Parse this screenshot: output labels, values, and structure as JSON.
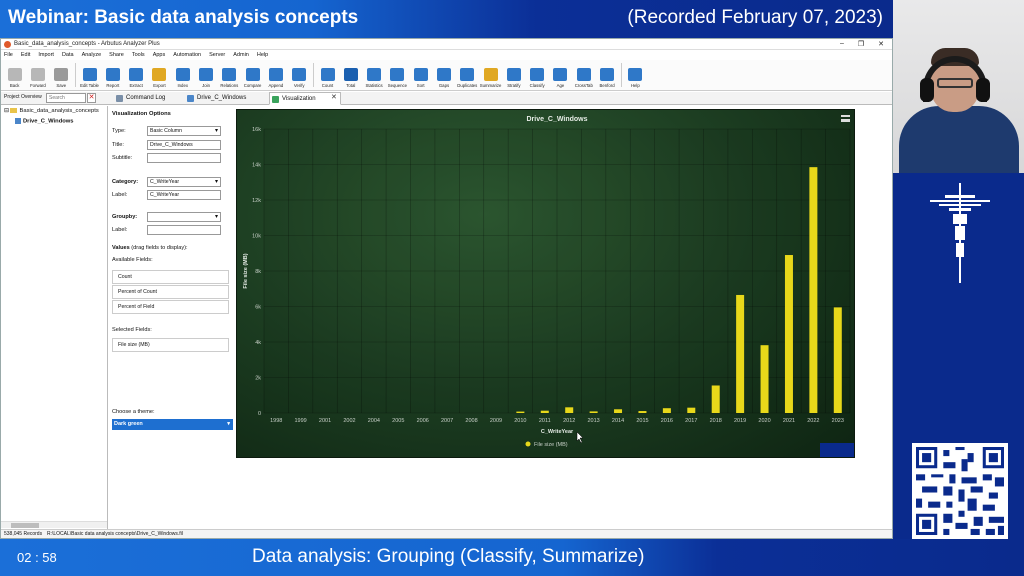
{
  "banner": {
    "title": "Webinar: Basic data analysis concepts",
    "date": "(Recorded February 07, 2023)"
  },
  "window": {
    "title": "Basic_data_analysis_concepts - Arbutus Analyzer Plus",
    "controls": [
      "–",
      "❐",
      "✕"
    ]
  },
  "menu": [
    "File",
    "Edit",
    "Import",
    "Data",
    "Analyze",
    "Share",
    "Tools",
    "Apps",
    "Automation",
    "Server",
    "Admin",
    "Help"
  ],
  "toolbar": [
    {
      "label": "Back",
      "color": "#b7b7b7"
    },
    {
      "label": "Forward",
      "color": "#b7b7b7"
    },
    {
      "label": "Save",
      "color": "#9a9a9a"
    },
    {
      "label": "Edit Table",
      "color": "#2f78c8"
    },
    {
      "label": "Report",
      "color": "#2f78c8"
    },
    {
      "label": "Extract",
      "color": "#2f78c8"
    },
    {
      "label": "Export",
      "color": "#e0a823"
    },
    {
      "label": "Index",
      "color": "#2f78c8"
    },
    {
      "label": "Join",
      "color": "#2f78c8"
    },
    {
      "label": "Relations",
      "color": "#2f78c8"
    },
    {
      "label": "Compare",
      "color": "#2f78c8"
    },
    {
      "label": "Append",
      "color": "#2f78c8"
    },
    {
      "label": "Verify",
      "color": "#2f78c8"
    },
    {
      "label": "Count",
      "color": "#2f78c8"
    },
    {
      "label": "Total",
      "color": "#1a5fb0"
    },
    {
      "label": "Statistics",
      "color": "#2f78c8"
    },
    {
      "label": "Sequence",
      "color": "#2f78c8"
    },
    {
      "label": "Sort",
      "color": "#2f78c8"
    },
    {
      "label": "Gaps",
      "color": "#2f78c8"
    },
    {
      "label": "Duplicates",
      "color": "#2f78c8"
    },
    {
      "label": "Summarize",
      "color": "#e0a823"
    },
    {
      "label": "Stratify",
      "color": "#2f78c8"
    },
    {
      "label": "Classify",
      "color": "#2f78c8"
    },
    {
      "label": "Age",
      "color": "#2f78c8"
    },
    {
      "label": "CrossTab",
      "color": "#2f78c8"
    },
    {
      "label": "Benford",
      "color": "#2f78c8"
    },
    {
      "label": "Help",
      "color": "#2f78c8"
    }
  ],
  "project": {
    "label": "Project Overview",
    "search_placeholder": "Search",
    "root": "Basic_data_analysis_concepts",
    "child": "Drive_C_Windows"
  },
  "tabs": [
    {
      "label": "Command Log",
      "active": false
    },
    {
      "label": "Drive_C_Windows",
      "active": false
    },
    {
      "label": "Visualization",
      "active": true
    }
  ],
  "options": {
    "heading": "Visualization Options",
    "type_label": "Type:",
    "type_value": "Basic Column",
    "title_label": "Title:",
    "title_value": "Drive_C_Windows",
    "subtitle_label": "Subtitle:",
    "subtitle_value": "",
    "category_label": "Category:",
    "category_value": "C_WriteYear",
    "cat_label_label": "Label:",
    "cat_label_value": "C_WriteYear",
    "groupby_label": "Groupby:",
    "groupby_value": "",
    "group_label_label": "Label:",
    "group_label_value": "",
    "values_heading": "Values",
    "values_hint": "(drag fields to display):",
    "available_label": "Available Fields:",
    "available_fields": [
      "Count",
      "Percent of Count",
      "Percent of Field"
    ],
    "selected_label": "Selected Fields:",
    "selected_fields": [
      "File size (MB)"
    ],
    "theme_label": "Choose a theme:",
    "theme_value": "Dark green"
  },
  "chart_data": {
    "type": "bar",
    "title": "Drive_C_Windows",
    "xlabel": "C_WriteYear",
    "ylabel": "File size (MB)",
    "ylim": [
      0,
      16000
    ],
    "ytick_labels": [
      "0",
      "2k",
      "4k",
      "6k",
      "8k",
      "10k",
      "12k",
      "14k",
      "16k"
    ],
    "categories": [
      "1998",
      "1999",
      "2001",
      "2002",
      "2004",
      "2005",
      "2006",
      "2007",
      "2008",
      "2009",
      "2010",
      "2011",
      "2012",
      "2013",
      "2014",
      "2015",
      "2016",
      "2017",
      "2018",
      "2019",
      "2020",
      "2021",
      "2022",
      "2023"
    ],
    "series": [
      {
        "name": "File size (MB)",
        "color": "#e8d81a",
        "values": [
          0,
          0,
          0,
          0,
          0,
          0,
          0,
          0,
          0,
          0,
          80,
          130,
          320,
          90,
          210,
          110,
          270,
          300,
          1550,
          6650,
          3820,
          8900,
          13850,
          5950
        ]
      }
    ],
    "grid": true,
    "legend": "bottom-center"
  },
  "status": {
    "records": "538,045 Records",
    "path": "R:\\LOCAL\\Basic data analysis concepts\\Drive_C_Windows.fil"
  },
  "footer": {
    "time": "02 : 58",
    "title": "Data analysis: Grouping (Classify, Summarize)"
  }
}
